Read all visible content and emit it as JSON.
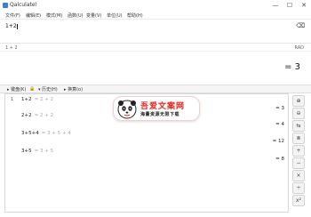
{
  "window": {
    "title": "Qalculate!",
    "minimize": "—",
    "maximize": "☐",
    "close": "✕"
  },
  "menu": [
    "文件(F)",
    "编辑(E)",
    "模式(M)",
    "函数(U)",
    "变量(V)",
    "单位(U)",
    "帮助(H)"
  ],
  "expression": {
    "value": "1+2",
    "clear_icon": "⌫"
  },
  "status": {
    "parsed": "1 + 2",
    "angle_mode": "RAD"
  },
  "result": {
    "value": "= 3"
  },
  "history_toolbar": {
    "keypad": "▸ 键盘(K)",
    "lock": "🔒",
    "history": "▾ 历史(H)",
    "convert": "▸ 换算(o)"
  },
  "history": [
    {
      "num": "1",
      "expr": "1+2",
      "parsed": "= 2 + 2",
      "result": "= 3"
    },
    {
      "num": "",
      "expr": "2+2",
      "parsed": "= 2 + 2",
      "result": "= 4"
    },
    {
      "num": "",
      "expr": "3+5+4",
      "parsed": "= 3 + 5 + 4",
      "result": "= 12"
    },
    {
      "num": "",
      "expr": "3+5",
      "parsed": "= 3 + 5",
      "result": "= 8"
    }
  ],
  "side_buttons": [
    "⊕",
    "⊖",
    "⇆",
    "⊗",
    "+",
    "−",
    "×",
    "÷",
    "x²",
    "√"
  ],
  "watermark": {
    "title": "吾爱文案网",
    "subtitle": "海量资源无限下载"
  }
}
